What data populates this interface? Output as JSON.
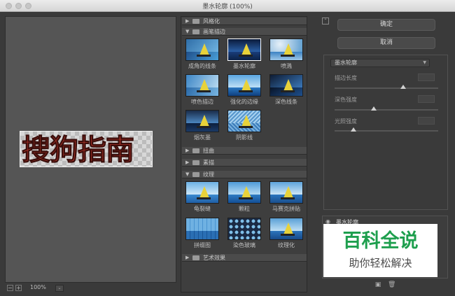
{
  "window": {
    "title": "墨水轮廓 (100%)"
  },
  "preview": {
    "sample_text": "搜狗指南"
  },
  "zoom": {
    "value": "100%",
    "minus": "−",
    "plus": "+",
    "dropdown": "⌄"
  },
  "gallery": {
    "categories": [
      {
        "label": "风格化",
        "expanded": false
      },
      {
        "label": "画笔描边",
        "expanded": true
      },
      {
        "label": "扭曲",
        "expanded": false
      },
      {
        "label": "素描",
        "expanded": false
      },
      {
        "label": "纹理",
        "expanded": true
      },
      {
        "label": "艺术效果",
        "expanded": false
      }
    ],
    "brush_filters": [
      "成角的线条",
      "墨水轮廓",
      "喷溅",
      "喷色描边",
      "强化的边缘",
      "深色线条",
      "烟灰墨",
      "阴影线"
    ],
    "texture_filters": [
      "龟裂缝",
      "颗粒",
      "马赛克拼贴",
      "拼缀图",
      "染色玻璃",
      "纹理化"
    ]
  },
  "buttons": {
    "ok": "确定",
    "cancel": "取消"
  },
  "settings": {
    "filter_select": "墨水轮廓",
    "params": [
      {
        "label": "描边长度",
        "value": "",
        "level": 0.66
      },
      {
        "label": "深色强度",
        "value": "",
        "level": 0.38
      },
      {
        "label": "光照强度",
        "value": "",
        "level": 0.18
      }
    ]
  },
  "layers": {
    "item": "墨水轮廓"
  },
  "watermark": {
    "line1": "百科全说",
    "line2": "助你轻松解决"
  }
}
